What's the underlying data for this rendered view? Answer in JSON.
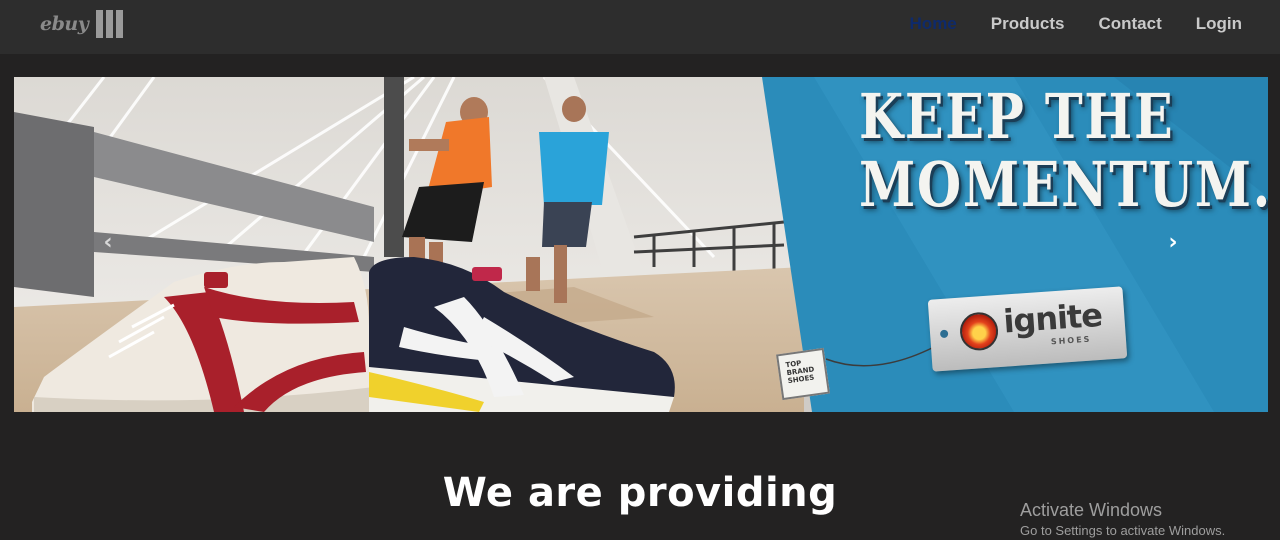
{
  "navbar": {
    "logo_text": "ebuy",
    "links": [
      {
        "label": "Home",
        "active": true
      },
      {
        "label": "Products",
        "active": false
      },
      {
        "label": "Contact",
        "active": false
      },
      {
        "label": "Login",
        "active": false
      }
    ]
  },
  "carousel": {
    "headline_line1": "KEEP THE",
    "headline_line2": "MOMENTUM...",
    "brand_tag": "ignite",
    "brand_tag_sub": "SHOES",
    "mini_tag": "TOP BRAND SHOES",
    "prev_icon": "chevron-left-icon",
    "next_icon": "chevron-right-icon",
    "prev_glyph": "‹",
    "next_glyph": "›"
  },
  "main": {
    "section_title": "We are providing"
  },
  "watermark": {
    "title": "Activate Windows",
    "subtitle": "Go to Settings to activate Windows."
  },
  "colors": {
    "page_bg": "#232222",
    "navbar_bg": "#2d2d2d",
    "nav_active": "#0e2a6b",
    "nav_link": "#c9c9c9",
    "banner_blue": "#2b8cba"
  }
}
